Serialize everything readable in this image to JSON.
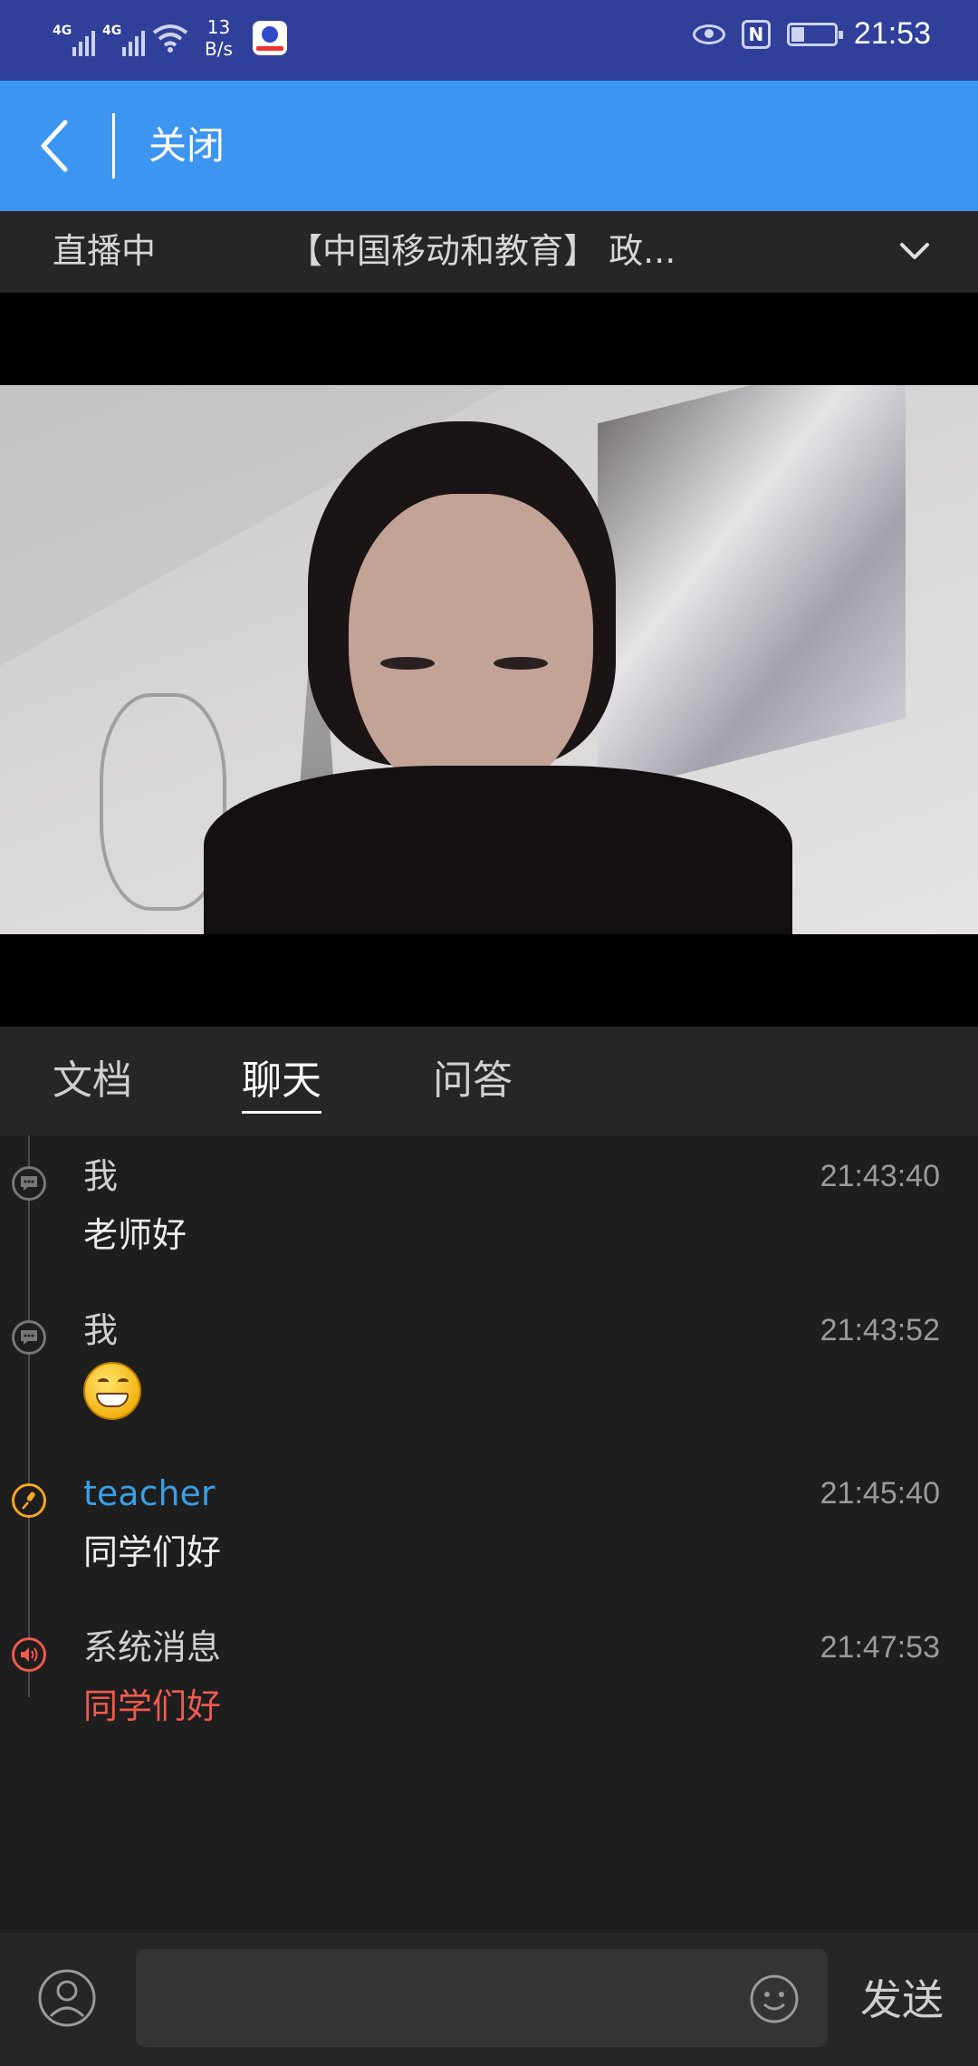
{
  "status_bar": {
    "network1": "4G",
    "network2": "4G",
    "speed_value": "13",
    "speed_unit": "B/s",
    "nfc_label": "N",
    "time": "21:53"
  },
  "top_bar": {
    "close_label": "关闭"
  },
  "live_bar": {
    "status": "直播中",
    "title": "【中国移动和教育】 政..."
  },
  "tabs": [
    {
      "label": "文档",
      "active": false
    },
    {
      "label": "聊天",
      "active": true
    },
    {
      "label": "问答",
      "active": false
    }
  ],
  "chat": {
    "messages": [
      {
        "sender": "我",
        "time": "21:43:40",
        "text": "老师好",
        "icon": "chat-bubble-icon"
      },
      {
        "sender": "我",
        "time": "21:43:52",
        "text": "",
        "emoji": "grinning-face-emoji",
        "icon": "chat-bubble-icon"
      },
      {
        "sender": "teacher",
        "time": "21:45:40",
        "text": "同学们好",
        "icon": "microphone-icon",
        "sender_color": "#3a9ee6"
      },
      {
        "sender": "系统消息",
        "time": "21:47:53",
        "text": "同学们好",
        "icon": "speaker-icon",
        "text_color": "#f05a4f"
      }
    ]
  },
  "bottom_bar": {
    "input_placeholder": "",
    "send_label": "发送"
  },
  "colors": {
    "status_bar": "#2f3f9a",
    "top_bar": "#3d95f2",
    "teacher_accent": "#f5a623",
    "system_accent": "#f05a4f"
  }
}
